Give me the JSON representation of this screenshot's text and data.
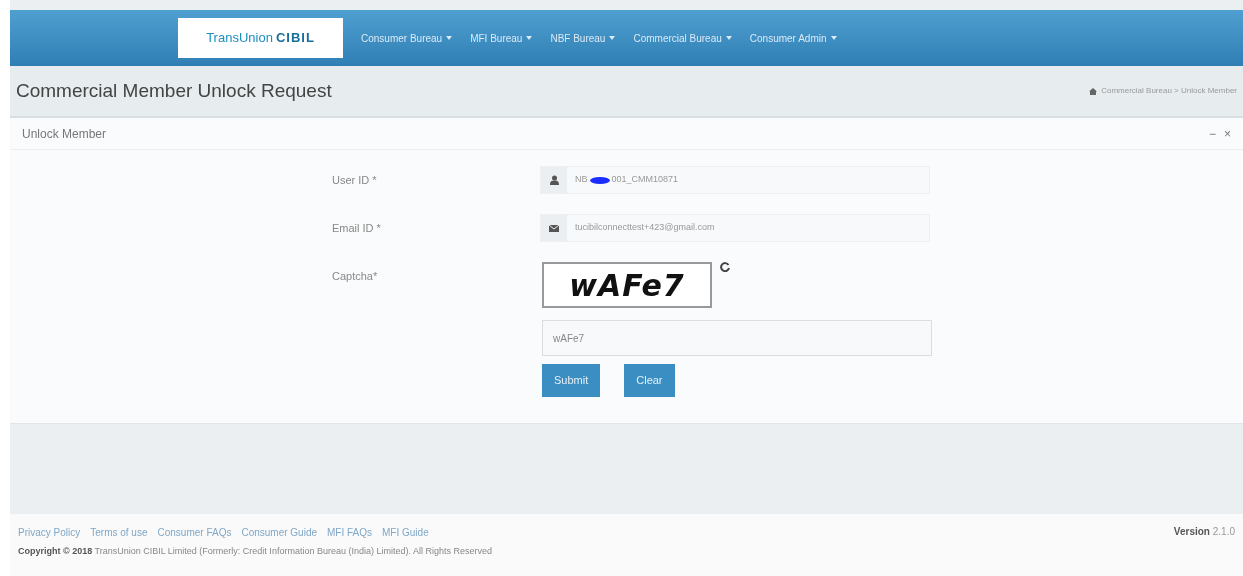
{
  "brand": {
    "left": "TransUnion",
    "right": "CIBIL"
  },
  "menu": [
    {
      "label": "Consumer Bureau"
    },
    {
      "label": "MFI Bureau"
    },
    {
      "label": "NBF Bureau"
    },
    {
      "label": "Commercial Bureau"
    },
    {
      "label": "Consumer Admin"
    }
  ],
  "page_title": "Commercial Member Unlock Request",
  "breadcrumb": "Commercial Bureau > Unlock Member",
  "panel": {
    "title": "Unlock Member",
    "tools": [
      "−",
      "×"
    ]
  },
  "form": {
    "fields": [
      {
        "kind": "user-input",
        "label": "User ID *",
        "value_start": "NB",
        "redacted": true,
        "value_end": "001_CMM10871"
      },
      {
        "kind": "email-input",
        "label": "Email ID *",
        "value_start": "tucibilconnecttest+423@gmail.com",
        "redacted": false
      },
      {
        "kind": "captcha",
        "label": "Captcha*",
        "captcha_text": "wAFe7",
        "value": "wAFe7"
      }
    ],
    "buttons": [
      "Submit",
      "Clear"
    ]
  },
  "footer": {
    "links": [
      "Privacy Policy",
      "Terms of use",
      "Consumer FAQs",
      "Consumer Guide",
      "MFI FAQs",
      "MFI Guide"
    ],
    "copyright": "**Copyright © 2018** TransUnion CIBIL Limited (Formerly: Credit Information Bureau (India) Limited). All Rights Reserved",
    "version": "**Version** 2.1.0"
  }
}
